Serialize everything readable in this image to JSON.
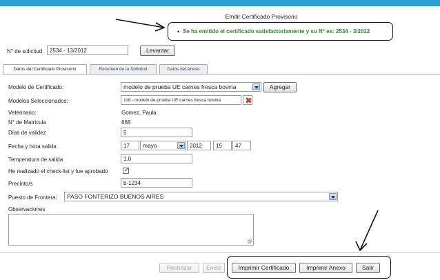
{
  "page": {
    "title": "Emitir Certificado Provisorio"
  },
  "notice": {
    "bullet": "•",
    "text": "Se ha emitido el certificado satisfactoriamente y su N° es: 2534 - 3/2012"
  },
  "solicitud": {
    "label": "N° de solicitud",
    "value": "2534 - 13/2012",
    "button": "Levantar"
  },
  "tabs": [
    {
      "label": "Datos del Certificado Provisorio",
      "active": true
    },
    {
      "label": "Resumen de la Solicitud",
      "active": false
    },
    {
      "label": "Datos del Anexo",
      "active": false
    }
  ],
  "form": {
    "modelo": {
      "label": "Modelo de Certificado:",
      "value": "modelo de prueba UE carnes fresca bovina",
      "button": "Agregar"
    },
    "seleccionados": {
      "label": "Modelos Seleccionados:",
      "value": "118 - modelo de prueba UE carnes fresca bovina"
    },
    "veterinario": {
      "label": "Veterinario:",
      "value": "Gomez, Paula"
    },
    "matricula": {
      "label": "N° de Matricula",
      "value": "668"
    },
    "dias": {
      "label": "Días de validez",
      "value": "5"
    },
    "fecha": {
      "label": "Fecha y hora salida",
      "day": "17",
      "month": "mayo",
      "year": "2012",
      "hour": "15",
      "minute": "47"
    },
    "temperatura": {
      "label": "Temperatura de salida",
      "value": "1.0"
    },
    "checklist": {
      "label": "He realizado el check-list y fue aprobado",
      "checked": true
    },
    "precinto": {
      "label": "Precinto/s",
      "value": "b-1234"
    },
    "frontera": {
      "label": "Puesto de Frontera:",
      "value": "PASO FONTERIZO BUENOS AIRES"
    },
    "observaciones": {
      "label": "Observaciones",
      "value": ""
    }
  },
  "actions": {
    "rechazar": "Rechazar",
    "emitir": "Emitir",
    "imprimir_certificado": "Imprimir Certificado",
    "imprimir_anexo": "Imprimir Anexo",
    "salir": "Salir"
  },
  "colors": {
    "topbar": "#2d9fd6",
    "success_text": "#2a8a2a",
    "tab_text": "#2a4a8a",
    "delete_icon": "#d23b2a"
  },
  "icons": [
    "chevron-down-icon",
    "delete-x-icon",
    "checkmark-icon",
    "resize-grip-icon"
  ]
}
